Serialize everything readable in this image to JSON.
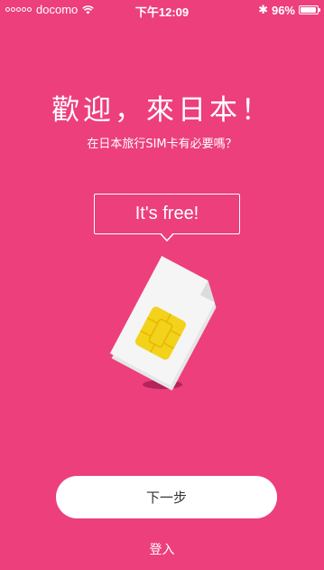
{
  "status_bar": {
    "carrier": "docomo",
    "time": "下午12:09",
    "battery_percent": "96%",
    "battery_level": 0.96,
    "bluetooth_glyph": "✱",
    "icons": [
      "signal-dots-icon",
      "wifi-icon",
      "bluetooth-icon",
      "battery-icon"
    ]
  },
  "welcome": {
    "title": "歡迎，來日本！",
    "subtitle": "在日本旅行SIM卡有必要嗎？"
  },
  "bubble": {
    "text": "It's free!"
  },
  "illustration": {
    "icon": "sim-card-icon"
  },
  "actions": {
    "next_label": "下一步",
    "login_label": "登入"
  },
  "colors": {
    "background": "#ec3f7c",
    "button_bg": "#ffffff",
    "sim_card": "#eeeeee",
    "sim_chip": "#f3d21c",
    "sim_shadow": "#b3235c"
  }
}
